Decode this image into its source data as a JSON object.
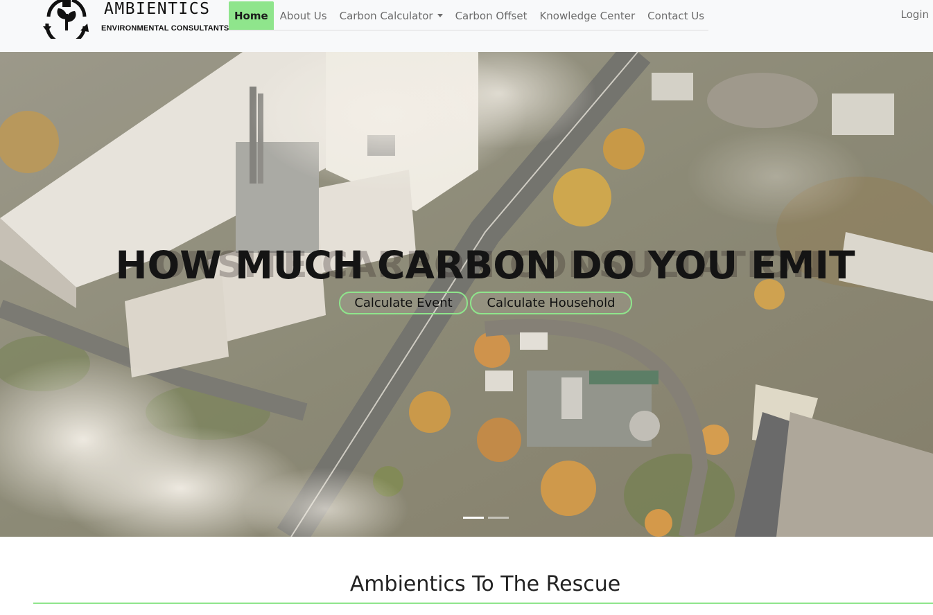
{
  "brand": {
    "name": "AMBIENTICS",
    "tagline": "ENVIRONMENTAL CONSULTANTS",
    "logo_icon": "leaf-plug-recycle-icon"
  },
  "nav": {
    "items": [
      {
        "label": "Home",
        "active": true
      },
      {
        "label": "About Us"
      },
      {
        "label": "Carbon Calculator",
        "dropdown": true
      },
      {
        "label": "Carbon Offset"
      },
      {
        "label": "Knowledge Center"
      },
      {
        "label": "Contact Us"
      }
    ],
    "login": "Login",
    "accent": "#8fe58c"
  },
  "hero": {
    "title": "HOW MUCH CARBON DO YOU EMIT",
    "ghost_title": "ONSITE CARBON CONSULTATION",
    "buttons": {
      "event": "Calculate Event",
      "household": "Calculate Household"
    },
    "slides": 2,
    "active_slide": 1,
    "background": "aerial-industrial-plant-smoke-image"
  },
  "section": {
    "title": "Ambientics To The Rescue"
  }
}
